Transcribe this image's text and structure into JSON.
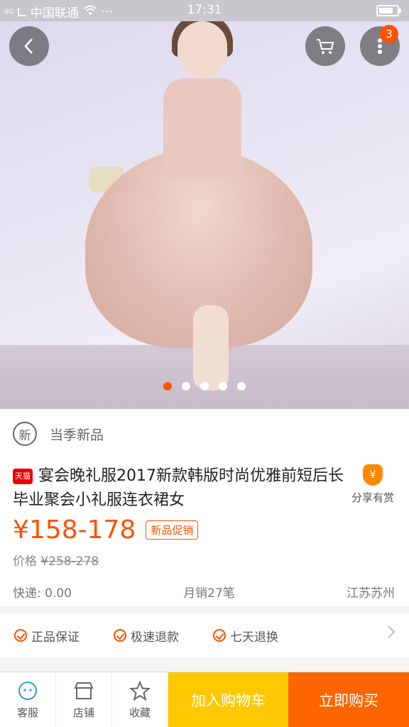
{
  "status_bar": {
    "network": "4G",
    "carrier": "中国联通",
    "more": "···",
    "time": "17:31",
    "battery_level": 0.8
  },
  "hero": {
    "carousel_count": 5,
    "active_index": 0
  },
  "header_buttons": {
    "back_icon": "chevron-left-icon",
    "cart_icon": "cart-icon",
    "more_icon": "more-dots-icon",
    "more_badge": "3"
  },
  "product": {
    "new_badge_char": "新",
    "new_label": "当季新品",
    "tmall_tag": "天猫",
    "title": "宴会晚礼服2017新款韩版时尚优雅前短后长毕业聚会小礼服连衣裙女",
    "share_icon_char": "¥",
    "share_label": "分享有赏",
    "price": "¥158-178",
    "promo_tag": "新品促销",
    "orig_price_label": "价格",
    "orig_price_value": "¥258-278",
    "shipping": "快递: 0.00",
    "monthly_sales": "月销27笔",
    "location": "江苏苏州"
  },
  "guarantees": [
    {
      "label": "正品保证"
    },
    {
      "label": "极速退款"
    },
    {
      "label": "七天退换"
    }
  ],
  "bottom_bar": {
    "service_label": "客服",
    "store_label": "店铺",
    "favorite_label": "收藏",
    "add_cart_label": "加入购物车",
    "buy_now_label": "立即购买"
  },
  "colors": {
    "accent": "#ff5000",
    "add_cart": "#ffc800",
    "buy_now": "#ff6600"
  }
}
